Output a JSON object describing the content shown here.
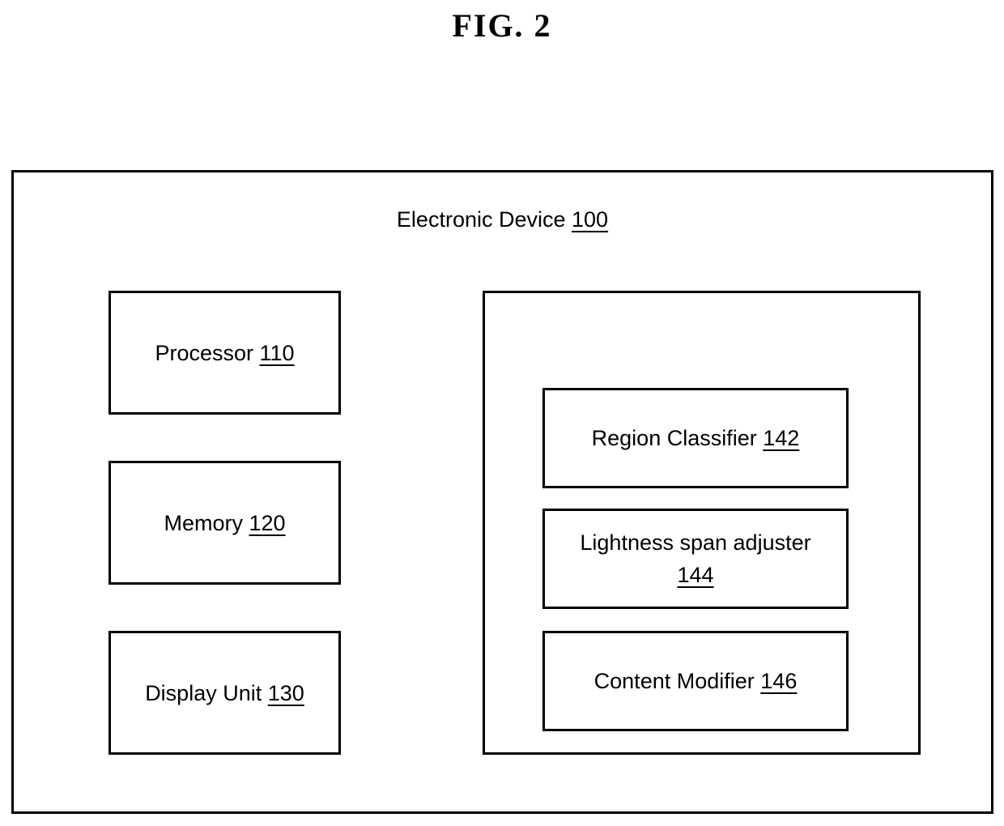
{
  "figure": {
    "title": "FIG. 2"
  },
  "device": {
    "label": "Electronic Device",
    "ref": "100"
  },
  "left_components": [
    {
      "label": "Processor",
      "ref": "110"
    },
    {
      "label": "Memory",
      "ref": "120"
    },
    {
      "label": "Display Unit",
      "ref": "130"
    }
  ],
  "right_components": [
    {
      "label": "Region Classifier",
      "ref": "142"
    },
    {
      "label": "Lightness span adjuster",
      "ref": "144"
    },
    {
      "label": "Content Modifier",
      "ref": "146"
    }
  ]
}
